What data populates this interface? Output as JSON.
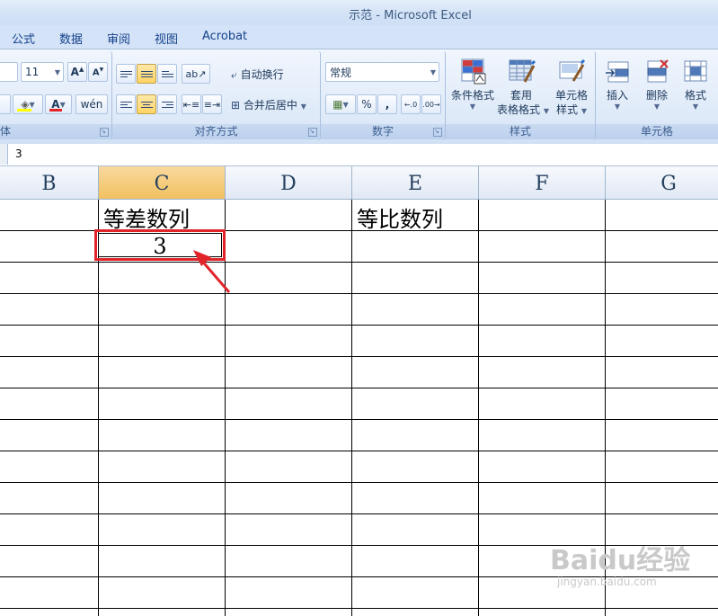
{
  "window": {
    "title": "示范 - Microsoft Excel"
  },
  "tabs": [
    "公式",
    "数据",
    "审阅",
    "视图",
    "Acrobat"
  ],
  "ribbon": {
    "font": {
      "size": "11",
      "group_label": "体"
    },
    "alignment": {
      "wrap_text": "自动换行",
      "merge_center": "合并后居中",
      "group_label": "对齐方式"
    },
    "number": {
      "format": "常规",
      "percent": "%",
      "comma": ",",
      "group_label": "数字"
    },
    "styles": {
      "conditional_format": "条件格式",
      "table_format_1": "套用",
      "table_format_2": "表格格式",
      "cell_styles_1": "单元格",
      "cell_styles_2": "样式",
      "group_label": "样式"
    },
    "cells": {
      "insert": "插入",
      "delete": "删除",
      "format": "格式",
      "group_label": "单元格"
    }
  },
  "formula_bar": {
    "value": "3"
  },
  "sheet": {
    "columns": [
      "B",
      "C",
      "D",
      "E",
      "F",
      "G"
    ],
    "selected_column": "C",
    "cells": {
      "C_header": "等差数列",
      "E_header": "等比数列",
      "C_active": "3"
    }
  },
  "annotation": {
    "color": "#e0242a"
  },
  "watermark": {
    "brand": "Baidu经验",
    "url": "jingyan.baidu.com"
  }
}
